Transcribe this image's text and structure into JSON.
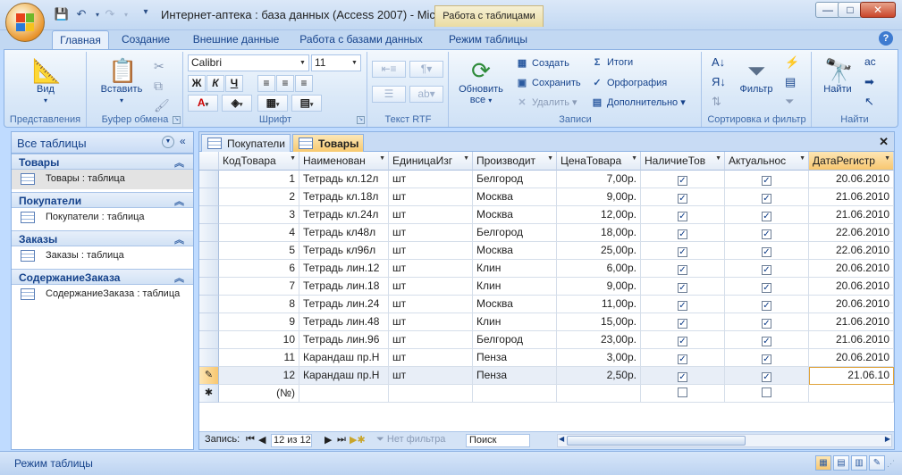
{
  "window": {
    "title": "Интернет-аптека : база данных (Access 2007) - Micr...",
    "context_tab": "Работа с таблицами",
    "min": "—",
    "max": "□",
    "close": "✕"
  },
  "ribbon_tabs": [
    "Главная",
    "Создание",
    "Внешние данные",
    "Работа с базами данных",
    "Режим таблицы"
  ],
  "groups": {
    "views": {
      "label": "Представления",
      "view": "Вид"
    },
    "clipboard": {
      "label": "Буфер обмена",
      "paste": "Вставить"
    },
    "font": {
      "label": "Шрифт",
      "font_name": "Calibri",
      "font_size": "11"
    },
    "rtf": {
      "label": "Текст RTF"
    },
    "records": {
      "label": "Записи",
      "refresh": "Обновить все",
      "new": "Создать",
      "save": "Сохранить",
      "delete": "Удалить",
      "totals": "Итоги",
      "spelling": "Орфография",
      "more": "Дополнительно"
    },
    "sortfilter": {
      "label": "Сортировка и фильтр",
      "filter": "Фильтр"
    },
    "find": {
      "label": "Найти",
      "find": "Найти"
    }
  },
  "nav": {
    "header": "Все таблицы",
    "sections": [
      {
        "title": "Товары",
        "item": "Товары : таблица"
      },
      {
        "title": "Покупатели",
        "item": "Покупатели : таблица"
      },
      {
        "title": "Заказы",
        "item": "Заказы : таблица"
      },
      {
        "title": "СодержаниеЗаказа",
        "item": "СодержаниеЗаказа : таблица"
      }
    ]
  },
  "doc_tabs": [
    "Покупатели",
    "Товары"
  ],
  "columns": [
    "КодТовара",
    "Наименован",
    "ЕдиницаИзг",
    "Производит",
    "ЦенаТовара",
    "НаличиеТов",
    "Актуальнос",
    "ДатаРегистр"
  ],
  "rows": [
    {
      "id": "1",
      "name": "Тетрадь кл.12л",
      "unit": "шт",
      "maker": "Белгород",
      "price": "7,00р.",
      "avail": true,
      "actual": true,
      "date": "20.06.2010"
    },
    {
      "id": "2",
      "name": "Тетрадь кл.18л",
      "unit": "шт",
      "maker": "Москва",
      "price": "9,00р.",
      "avail": true,
      "actual": true,
      "date": "21.06.2010"
    },
    {
      "id": "3",
      "name": "Тетрадь кл.24л",
      "unit": "шт",
      "maker": "Москва",
      "price": "12,00р.",
      "avail": true,
      "actual": true,
      "date": "21.06.2010"
    },
    {
      "id": "4",
      "name": "Тетрадь кл48л",
      "unit": "шт",
      "maker": "Белгород",
      "price": "18,00р.",
      "avail": true,
      "actual": true,
      "date": "22.06.2010"
    },
    {
      "id": "5",
      "name": "Тетрадь кл96л",
      "unit": "шт",
      "maker": "Москва",
      "price": "25,00р.",
      "avail": true,
      "actual": true,
      "date": "22.06.2010"
    },
    {
      "id": "6",
      "name": "Тетрадь лин.12",
      "unit": "шт",
      "maker": "Клин",
      "price": "6,00р.",
      "avail": true,
      "actual": true,
      "date": "20.06.2010"
    },
    {
      "id": "7",
      "name": "Тетрадь лин.18",
      "unit": "шт",
      "maker": "Клин",
      "price": "9,00р.",
      "avail": true,
      "actual": true,
      "date": "20.06.2010"
    },
    {
      "id": "8",
      "name": "Тетрадь лин.24",
      "unit": "шт",
      "maker": "Москва",
      "price": "11,00р.",
      "avail": true,
      "actual": true,
      "date": "20.06.2010"
    },
    {
      "id": "9",
      "name": "Тетрадь лин.48",
      "unit": "шт",
      "maker": "Клин",
      "price": "15,00р.",
      "avail": true,
      "actual": true,
      "date": "21.06.2010"
    },
    {
      "id": "10",
      "name": "Тетрадь лин.96",
      "unit": "шт",
      "maker": "Белгород",
      "price": "23,00р.",
      "avail": true,
      "actual": true,
      "date": "21.06.2010"
    },
    {
      "id": "11",
      "name": "Карандаш пр.Н",
      "unit": "шт",
      "maker": "Пенза",
      "price": "3,00р.",
      "avail": true,
      "actual": true,
      "date": "20.06.2010"
    },
    {
      "id": "12",
      "name": "Карандаш пр.Н",
      "unit": "шт",
      "maker": "Пенза",
      "price": "2,50р.",
      "avail": true,
      "actual": true,
      "date": "21.06.10"
    }
  ],
  "new_row": {
    "id": "(№)"
  },
  "record_nav": {
    "label": "Запись:",
    "position": "12 из 12",
    "filter": "Нет фильтра",
    "search": "Поиск"
  },
  "status": {
    "text": "Режим таблицы"
  },
  "colors": {
    "ribbon_blue": "#bfdbff",
    "active_orange": "#f8c770",
    "text_blue": "#15428b"
  }
}
